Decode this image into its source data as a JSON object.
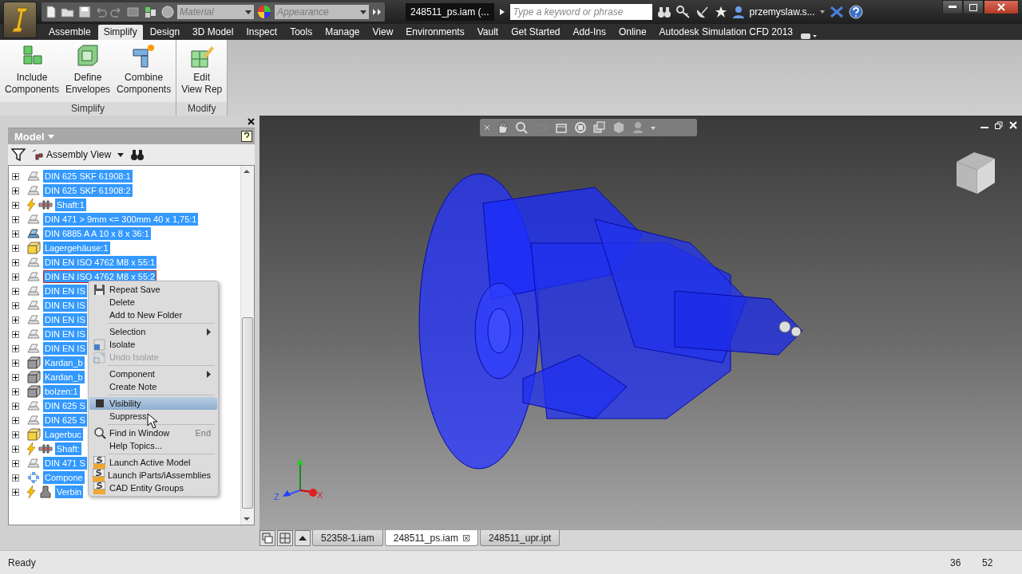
{
  "title_bar": {
    "material": "Material",
    "appearance": "Appearance",
    "document_title": "248511_ps.iam (...",
    "search": {
      "placeholder": "Type a keyword or phrase"
    },
    "user": "przemyslaw.s..."
  },
  "ribbon_tabs": [
    {
      "label": "Assemble",
      "selected": false
    },
    {
      "label": "Simplify",
      "selected": true
    },
    {
      "label": "Design",
      "selected": false
    },
    {
      "label": "3D Model",
      "selected": false
    },
    {
      "label": "Inspect",
      "selected": false
    },
    {
      "label": "Tools",
      "selected": false
    },
    {
      "label": "Manage",
      "selected": false
    },
    {
      "label": "View",
      "selected": false
    },
    {
      "label": "Environments",
      "selected": false
    },
    {
      "label": "Vault",
      "selected": false
    },
    {
      "label": "Get Started",
      "selected": false
    },
    {
      "label": "Add-Ins",
      "selected": false
    },
    {
      "label": "Online",
      "selected": false
    },
    {
      "label": "Autodesk Simulation CFD 2013",
      "selected": false
    }
  ],
  "ribbon_panels": [
    {
      "title": "Simplify",
      "buttons": [
        {
          "label": "Include\nComponents",
          "kind": "include"
        },
        {
          "label": "Define\nEnvelopes",
          "kind": "envelope"
        },
        {
          "label": "Combine\nComponents",
          "kind": "combine"
        }
      ]
    },
    {
      "title": "Modify",
      "buttons": [
        {
          "label": "Edit\nView Rep",
          "kind": "viewrep"
        }
      ]
    }
  ],
  "browser": {
    "title": "Model",
    "view": "Assembly View",
    "tree": [
      {
        "label": "DIN 625 SKF 61908:1",
        "kind": "part",
        "flexible": false,
        "selected": true,
        "focused": false
      },
      {
        "label": "DIN 625 SKF 61908:2",
        "kind": "part",
        "flexible": false,
        "selected": true,
        "focused": false
      },
      {
        "label": "Shaft:1",
        "kind": "shaft",
        "flexible": true,
        "selected": true,
        "focused": false
      },
      {
        "label": "DIN 471 > 9mm <= 300mm 40 x 1,75:1",
        "kind": "part",
        "flexible": false,
        "selected": true,
        "focused": false
      },
      {
        "label": "DIN 6885 A A 10 x 8 x 36:1",
        "kind": "key",
        "flexible": false,
        "selected": true,
        "focused": false
      },
      {
        "label": "Lagergehäuse:1",
        "kind": "assembly",
        "flexible": false,
        "selected": true,
        "focused": false
      },
      {
        "label": "DIN EN ISO 4762 M8 x 55:1",
        "kind": "part",
        "flexible": false,
        "selected": true,
        "focused": false
      },
      {
        "label": "DIN EN ISO 4762 M8 x 55:2",
        "kind": "part",
        "flexible": false,
        "selected": true,
        "focused": true
      },
      {
        "label": "DIN EN IS",
        "kind": "part",
        "flexible": false,
        "selected": true,
        "focused": false
      },
      {
        "label": "DIN EN IS",
        "kind": "part",
        "flexible": false,
        "selected": true,
        "focused": false
      },
      {
        "label": "DIN EN IS",
        "kind": "part",
        "flexible": false,
        "selected": true,
        "focused": false
      },
      {
        "label": "DIN EN IS",
        "kind": "part",
        "flexible": false,
        "selected": true,
        "focused": false
      },
      {
        "label": "DIN EN IS",
        "kind": "part",
        "flexible": false,
        "selected": true,
        "focused": false
      },
      {
        "label": "Kardan_b",
        "kind": "solid",
        "flexible": false,
        "selected": true,
        "focused": false
      },
      {
        "label": "Kardan_b",
        "kind": "solid",
        "flexible": false,
        "selected": true,
        "focused": false
      },
      {
        "label": "bolzen:1",
        "kind": "solid",
        "flexible": false,
        "selected": true,
        "focused": false
      },
      {
        "label": "DIN 625 S",
        "kind": "part",
        "flexible": false,
        "selected": true,
        "focused": false
      },
      {
        "label": "DIN 625 S",
        "kind": "part",
        "flexible": false,
        "selected": true,
        "focused": false
      },
      {
        "label": "Lagerbuc",
        "kind": "assembly",
        "flexible": false,
        "selected": true,
        "focused": false
      },
      {
        "label": "Shaft:",
        "kind": "shaft",
        "flexible": true,
        "selected": true,
        "focused": false
      },
      {
        "label": "DIN 471 S",
        "kind": "part",
        "flexible": false,
        "selected": true,
        "focused": false
      },
      {
        "label": "Compone",
        "kind": "pattern",
        "flexible": false,
        "selected": true,
        "focused": false
      },
      {
        "label": "Verbin",
        "kind": "connector",
        "flexible": true,
        "selected": true,
        "focused": false
      }
    ]
  },
  "context_menu": {
    "items": [
      {
        "kind": "save",
        "label": "Repeat Save",
        "disabled": false,
        "highlighted": false
      },
      {
        "kind": "plain",
        "label": "Delete",
        "disabled": false,
        "highlighted": false
      },
      {
        "kind": "plain",
        "label": "Add to New Folder",
        "disabled": false,
        "highlighted": false
      },
      {
        "kind": "separator"
      },
      {
        "kind": "submenu",
        "label": "Selection",
        "disabled": false,
        "highlighted": false
      },
      {
        "kind": "isolate",
        "label": "Isolate",
        "disabled": false,
        "highlighted": false
      },
      {
        "kind": "undo-isolate",
        "label": "Undo Isolate",
        "disabled": true,
        "highlighted": false
      },
      {
        "kind": "separator"
      },
      {
        "kind": "submenu",
        "label": "Component",
        "disabled": false,
        "highlighted": false
      },
      {
        "kind": "plain",
        "label": "Create Note",
        "disabled": false,
        "highlighted": false
      },
      {
        "kind": "separator"
      },
      {
        "kind": "check",
        "label": "Visibility",
        "disabled": false,
        "highlighted": true
      },
      {
        "kind": "plain",
        "label": "Suppress",
        "disabled": false,
        "highlighted": false
      },
      {
        "kind": "separator"
      },
      {
        "kind": "find",
        "label": "Find in Window",
        "shortcut": "End",
        "disabled": false,
        "highlighted": false
      },
      {
        "kind": "plain",
        "label": "Help Topics...",
        "disabled": false,
        "highlighted": false
      },
      {
        "kind": "separator"
      },
      {
        "kind": "cfd",
        "label": "Launch Active Model",
        "disabled": false,
        "highlighted": false
      },
      {
        "kind": "cfd",
        "label": "Launch iParts/iAssemblies",
        "disabled": false,
        "highlighted": false
      },
      {
        "kind": "cfd",
        "label": "CAD Entity Groups",
        "disabled": false,
        "highlighted": false
      }
    ]
  },
  "viewport": {
    "axes": {
      "z": "Z",
      "x": "X"
    }
  },
  "document_tabs": [
    {
      "label": "52358-1.iam",
      "selected": false
    },
    {
      "label": "248511_ps.iam",
      "selected": true
    },
    {
      "label": "248511_upr.ipt",
      "selected": false
    }
  ],
  "status_bar": {
    "text": "Ready",
    "fields": [
      "36",
      "52"
    ]
  }
}
